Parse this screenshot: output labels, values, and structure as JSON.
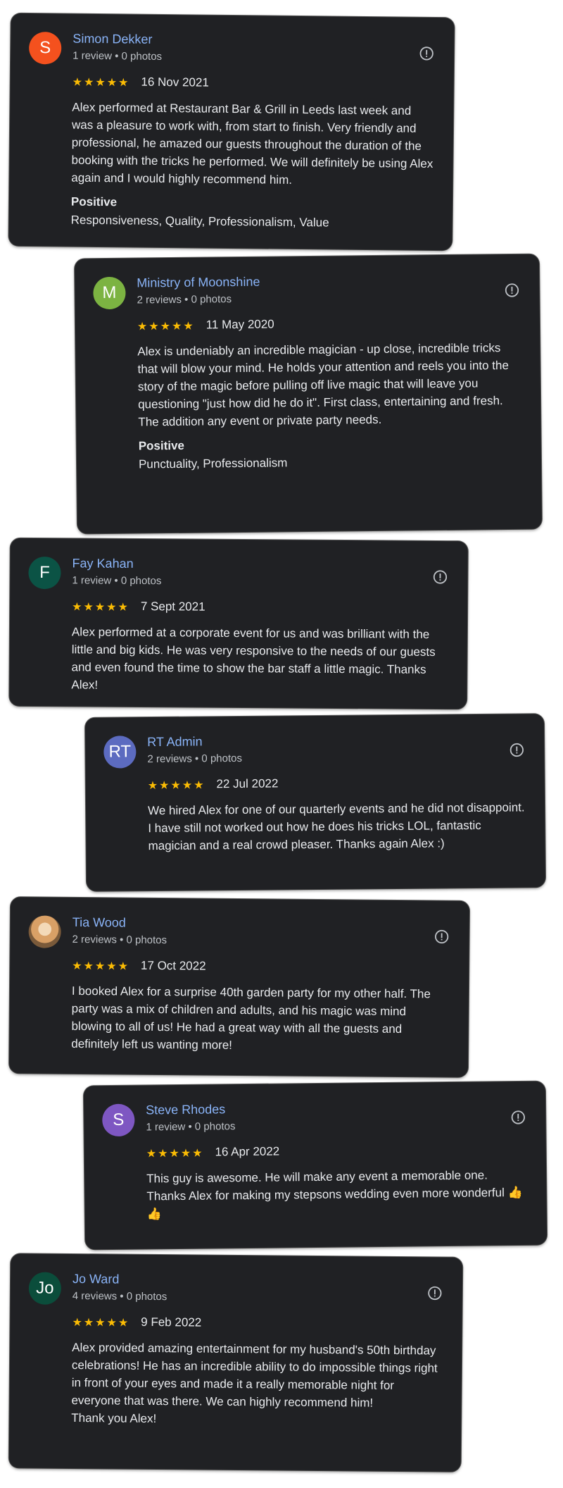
{
  "reviews": [
    {
      "name": "Simon Dekker",
      "meta": "1 review • 0 photos",
      "initial": "S",
      "avatar_color": "#f4511e",
      "stars": "★★★★★",
      "date": "16 Nov 2021",
      "text": "Alex performed at Restaurant Bar & Grill in Leeds last week and was a pleasure to work with, from start to finish. Very friendly and professional, he amazed our guests throughout the duration of the booking with the tricks he performed. We will definitely be using Alex again and I would highly recommend him.",
      "positive_title": "Positive",
      "positive_items": "Responsiveness, Quality, Professionalism, Value"
    },
    {
      "name": "Ministry of Moonshine",
      "meta": "2 reviews • 0 photos",
      "initial": "M",
      "avatar_color": "#7cb342",
      "stars": "★★★★★",
      "date": "11 May 2020",
      "text": "Alex is undeniably an incredible magician - up close, incredible tricks that will blow your mind. He holds your attention and reels you into the story of the magic before pulling off live magic that will leave you questioning \"just how did he do it\". First class, entertaining and fresh. The addition any event or private party needs.",
      "positive_title": "Positive",
      "positive_items": "Punctuality, Professionalism"
    },
    {
      "name": "Fay Kahan",
      "meta": "1 review • 0 photos",
      "initial": "F",
      "avatar_color": "#0b5345",
      "stars": "★★★★★",
      "date": "7 Sept 2021",
      "text": "Alex performed at a corporate event for us and was brilliant with the little and big kids. He was very responsive to the needs of our guests and even found the time to show the bar staff a little magic. Thanks Alex!"
    },
    {
      "name": "RT Admin",
      "meta": "2 reviews • 0 photos",
      "initial": "RT",
      "avatar_color": "#5c6bc0",
      "stars": "★★★★★",
      "date": "22 Jul 2022",
      "text": "We hired Alex for one of our quarterly events and he did not disappoint. I have still not worked out how he does his tricks LOL, fantastic magician and a real crowd pleaser. Thanks again Alex :)"
    },
    {
      "name": "Tia Wood",
      "meta": "2 reviews • 0 photos",
      "initial": "",
      "avatar_color": "#c58a52",
      "stars": "★★★★★",
      "date": "17 Oct 2022",
      "text": "I booked Alex for a surprise 40th garden party for my other half. The party was a mix of children and adults, and his magic was mind blowing to all of us! He had a great way with all the guests and definitely left us wanting more!"
    },
    {
      "name": "Steve Rhodes",
      "meta": "1 review • 0 photos",
      "initial": "S",
      "avatar_color": "#7e57c2",
      "stars": "★★★★★",
      "date": "16 Apr 2022",
      "text": "This guy is awesome. He will make any event a memorable one. Thanks Alex for making my stepsons wedding even more wonderful 👍👍"
    },
    {
      "name": "Jo Ward",
      "meta": "4 reviews • 0 photos",
      "initial": "Jo",
      "avatar_color": "#0b4d3b",
      "stars": "★★★★★",
      "date": "9 Feb 2022",
      "text": "Alex provided amazing entertainment for my husband's 50th birthday celebrations! He has an incredible ability to do impossible things right in front of your eyes and made it a really memorable night for everyone that was there. We can highly recommend him!\nThank you Alex!"
    }
  ]
}
